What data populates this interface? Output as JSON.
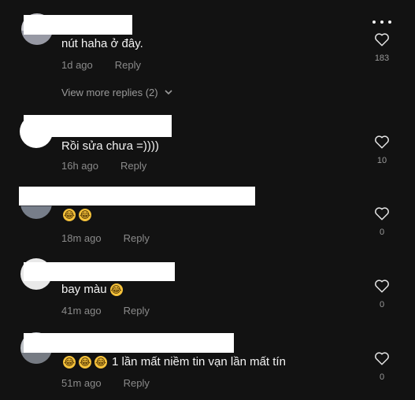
{
  "header": {
    "more_icon": "more-horizontal-icon"
  },
  "comments": [
    {
      "text": "nút haha ở đây.",
      "emojis": [],
      "time": "1d ago",
      "reply_label": "Reply",
      "likes": "183",
      "view_more_label": "View more replies (2)"
    },
    {
      "text": "Rồi sửa chưa =))))",
      "emojis": [],
      "time": "16h ago",
      "reply_label": "Reply",
      "likes": "10"
    },
    {
      "text": "",
      "emojis": [
        "😂",
        "😂"
      ],
      "time": "18m ago",
      "reply_label": "Reply",
      "likes": "0"
    },
    {
      "text": "bay màu",
      "emojis": [
        "😂"
      ],
      "time": "41m ago",
      "reply_label": "Reply",
      "likes": "0"
    },
    {
      "text": "1 lần mất niềm tin vạn lần mất tín",
      "emojis": [
        "😂",
        "😂",
        "😂"
      ],
      "time": "51m ago",
      "reply_label": "Reply",
      "likes": "0"
    }
  ],
  "colors": {
    "background": "#121212",
    "text": "#f3f3f3",
    "muted": "#8a8a8a",
    "emoji": "#f5c23b"
  },
  "icons": {
    "like": "heart-outline-icon",
    "expand": "chevron-down-icon",
    "emoji": "face-with-tears-of-joy-icon"
  }
}
